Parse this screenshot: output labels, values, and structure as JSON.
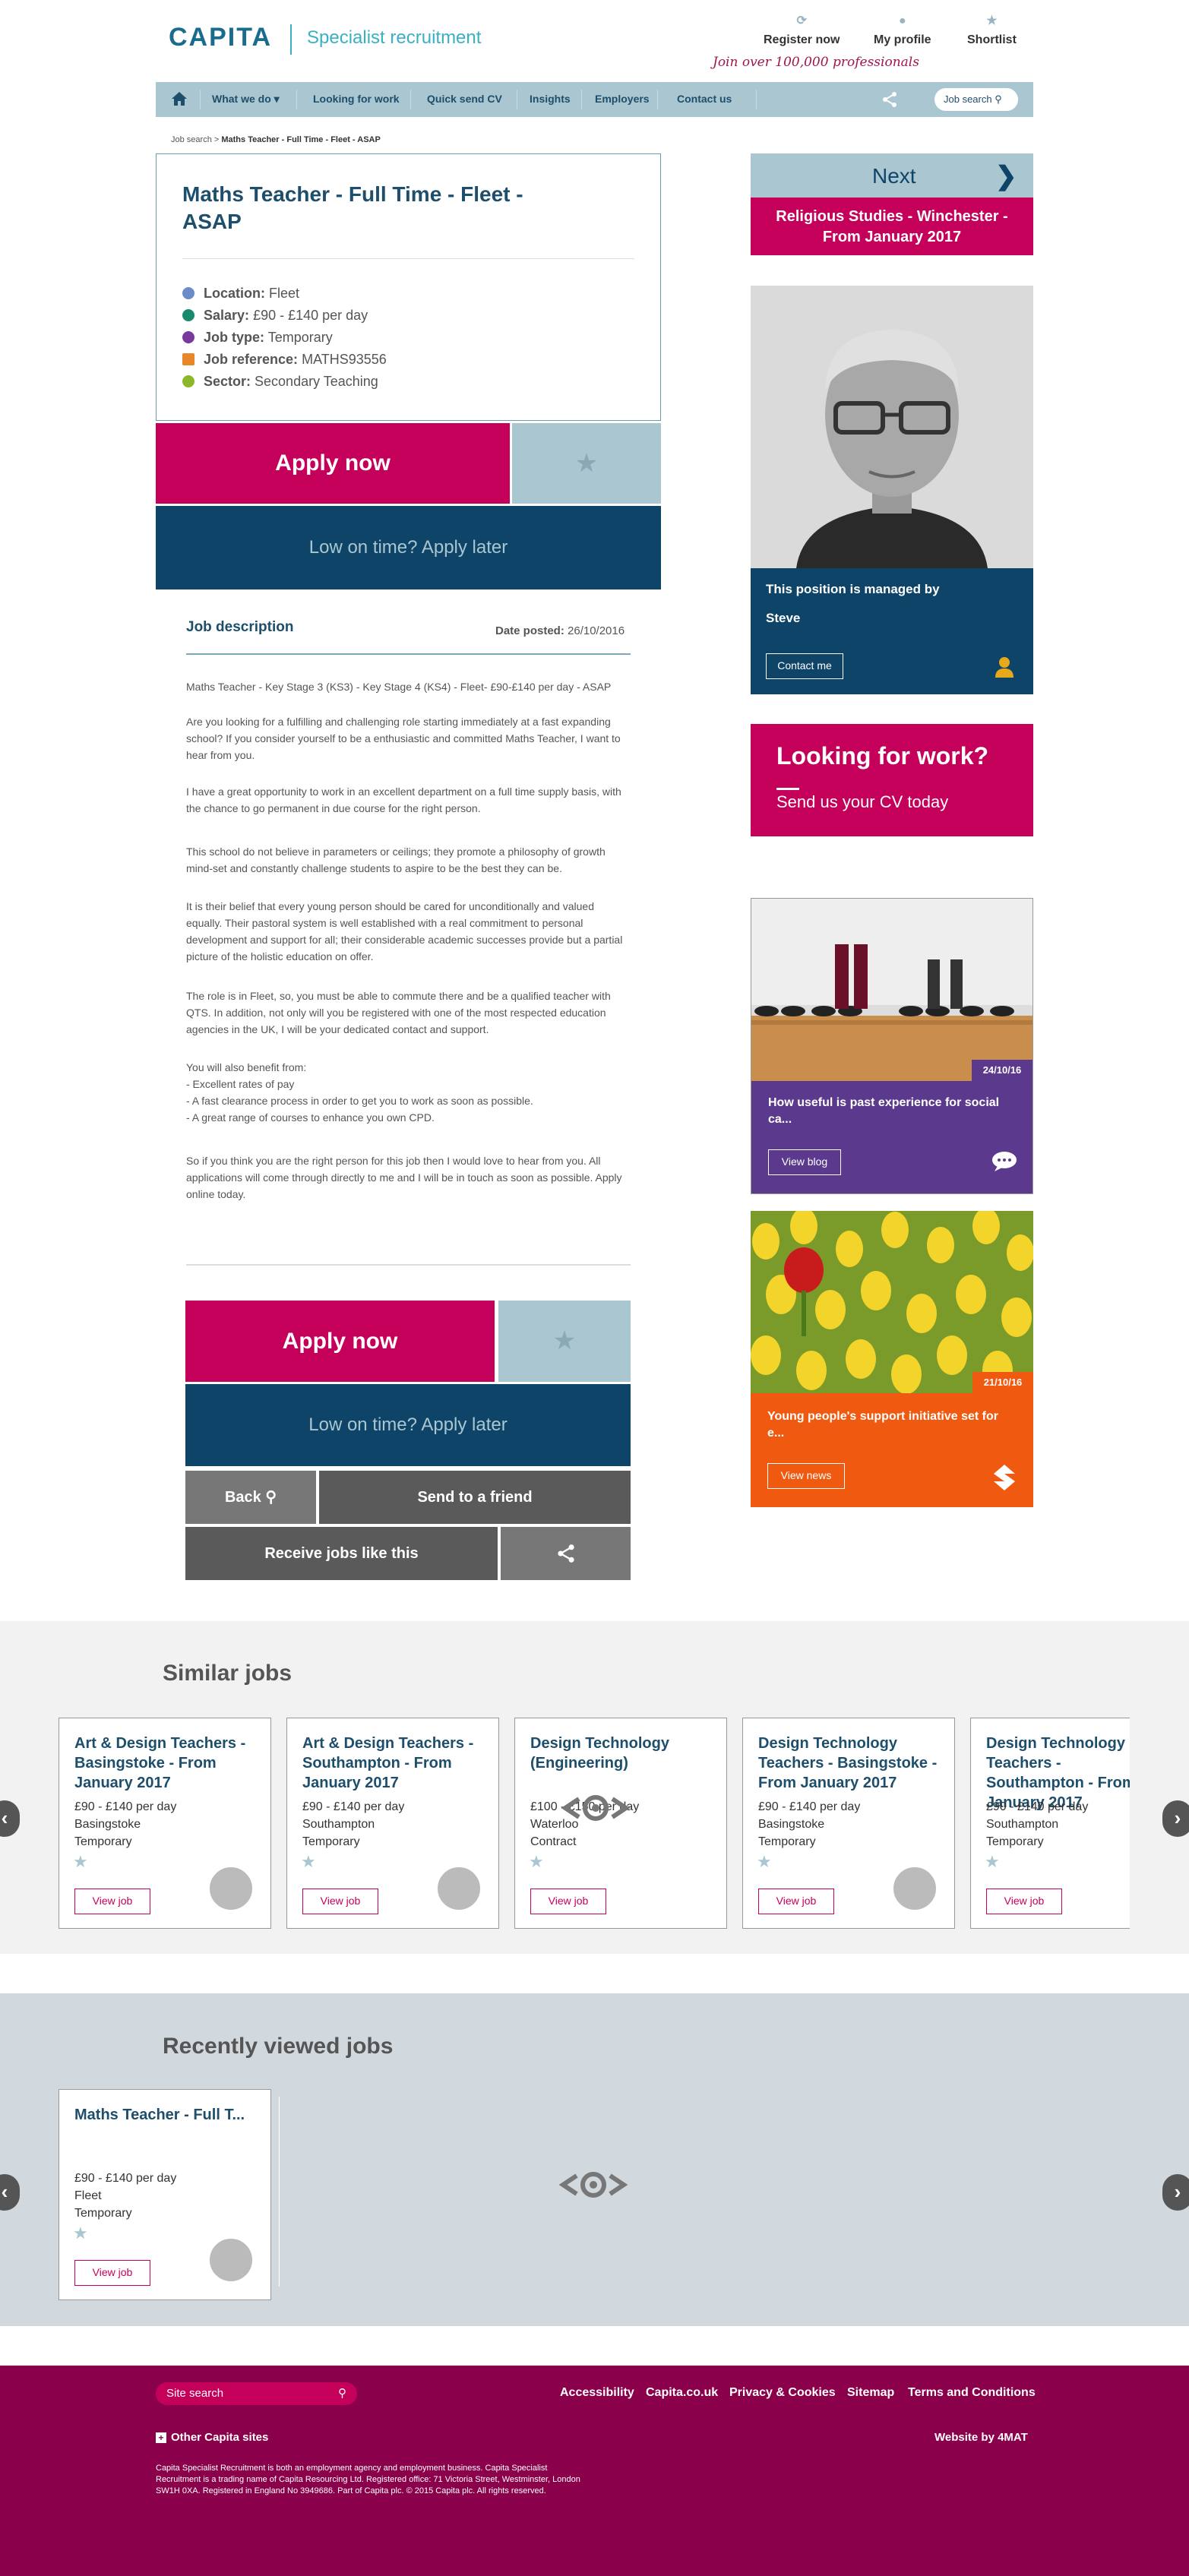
{
  "header": {
    "logo": "CAPITA",
    "subtitle": "Specialist recruitment",
    "links": [
      {
        "label": "Register now",
        "icon": "register-icon"
      },
      {
        "label": "My profile",
        "icon": "profile-icon"
      },
      {
        "label": "Shortlist",
        "icon": "star-icon"
      }
    ],
    "tagline": "Join over 100,000 professionals"
  },
  "nav": {
    "items": [
      "What we do",
      "Looking for work",
      "Quick send CV",
      "Insights",
      "Employers",
      "Contact us"
    ],
    "search_label": "Job search"
  },
  "breadcrumb": {
    "root": "Job search",
    "current": "Maths Teacher - Full Time - Fleet - ASAP"
  },
  "job": {
    "title": "Maths Teacher - Full Time - Fleet - ASAP",
    "location_label": "Location:",
    "location": "Fleet",
    "salary_label": "Salary:",
    "salary": "£90 - £140 per day",
    "type_label": "Job type:",
    "type": "Temporary",
    "ref_label": "Job reference:",
    "ref": "MATHS93556",
    "sector_label": "Sector:",
    "sector": "Secondary Teaching"
  },
  "actions": {
    "apply": "Apply now",
    "later": "Low on time? Apply later",
    "back": "Back",
    "send": "Send to a friend",
    "receive": "Receive jobs like this"
  },
  "description": {
    "heading": "Job description",
    "posted_label": "Date posted:",
    "posted": "26/10/2016",
    "paragraphs": [
      "Maths Teacher - Key Stage 3 (KS3) - Key Stage 4 (KS4) - Fleet- £90-£140 per day - ASAP",
      "Are you looking for a fulfilling and challenging role starting immediately at a fast expanding school? If you consider yourself to be a enthusiastic and committed Maths Teacher, I want to hear from you.",
      "I have a great opportunity to work in an excellent department on a full time supply basis, with the chance to go permanent in due course for the right person.",
      "This school do not believe in parameters or ceilings; they promote a philosophy of growth mind-set and constantly challenge students to aspire to be the best they can be.",
      "It is their belief that every young person should be cared for unconditionally and valued equally. Their pastoral system is well established with a real commitment to personal development and support for all; their considerable academic successes provide but a partial picture of the holistic education on offer.",
      "The role is in Fleet, so, you must be able to commute there and be a qualified teacher with QTS. In addition, not only will you be registered with one of the most respected education agencies in the UK, I will be your dedicated contact and support.",
      "You will also benefit from:\n- Excellent rates of pay\n- A fast clearance process in order to get you to work as soon as possible.\n- A great range of courses to enhance you own CPD.",
      "So if you think you are the right person for this job then I would love to hear from you. All applications will come through directly to me and I will be in touch as soon as possible. Apply online today."
    ]
  },
  "sidebar": {
    "next_label": "Next",
    "next_job": "Religious Studies - Winchester - From January 2017",
    "manager_text": "This position is managed by",
    "manager_name": "Steve",
    "contact": "Contact me",
    "look_title": "Looking for work?",
    "look_sub": "Send us your CV today",
    "blog_date": "24/10/16",
    "blog_title": "How useful is past experience for social ca...",
    "blog_btn": "View blog",
    "news_date": "21/10/16",
    "news_title": "Young people's support initiative set for e...",
    "news_btn": "View news"
  },
  "similar": {
    "heading": "Similar jobs",
    "view": "View job",
    "jobs": [
      {
        "title": "Art & Design Teachers - Basingstoke - From January 2017",
        "salary": "£90 - £140 per day",
        "location": "Basingstoke",
        "type": "Temporary"
      },
      {
        "title": "Art & Design Teachers - Southampton - From January 2017",
        "salary": "£90 - £140 per day",
        "location": "Southampton",
        "type": "Temporary"
      },
      {
        "title": "Design Technology (Engineering)",
        "salary": "£100 - £150 per day",
        "location": "Waterloo",
        "type": "Contract"
      },
      {
        "title": "Design Technology Teachers - Basingstoke - From January 2017",
        "salary": "£90 - £140 per day",
        "location": "Basingstoke",
        "type": "Temporary"
      },
      {
        "title": "Design Technology Teachers - Southampton - From January 2017",
        "salary": "£90 - £140 per day",
        "location": "Southampton",
        "type": "Temporary"
      }
    ]
  },
  "recent": {
    "heading": "Recently viewed jobs",
    "view": "View job",
    "job": {
      "title": "Maths Teacher - Full T...",
      "salary": "£90 - £140 per day",
      "location": "Fleet",
      "type": "Temporary"
    }
  },
  "footer": {
    "search": "Site search",
    "links": [
      "Accessibility",
      "Capita.co.uk",
      "Privacy & Cookies",
      "Sitemap",
      "Terms and Conditions"
    ],
    "other": "Other Capita sites",
    "credit": "Website by 4MAT",
    "legal": "Capita Specialist Recruitment is both an employment agency and employment business. Capita Specialist Recruitment is a trading name of Capita Resourcing Ltd. Registered office: 71 Victoria Street, Westminster, London SW1H 0XA. Registered in England No 3949686. Part of Capita plc. © 2015 Capita plc. All rights reserved."
  },
  "colors": {
    "brand": "#1a6c8c",
    "accent": "#c5005a",
    "navy": "#0e4468",
    "nav": "#a9c6d1",
    "footer": "#8a004b"
  }
}
